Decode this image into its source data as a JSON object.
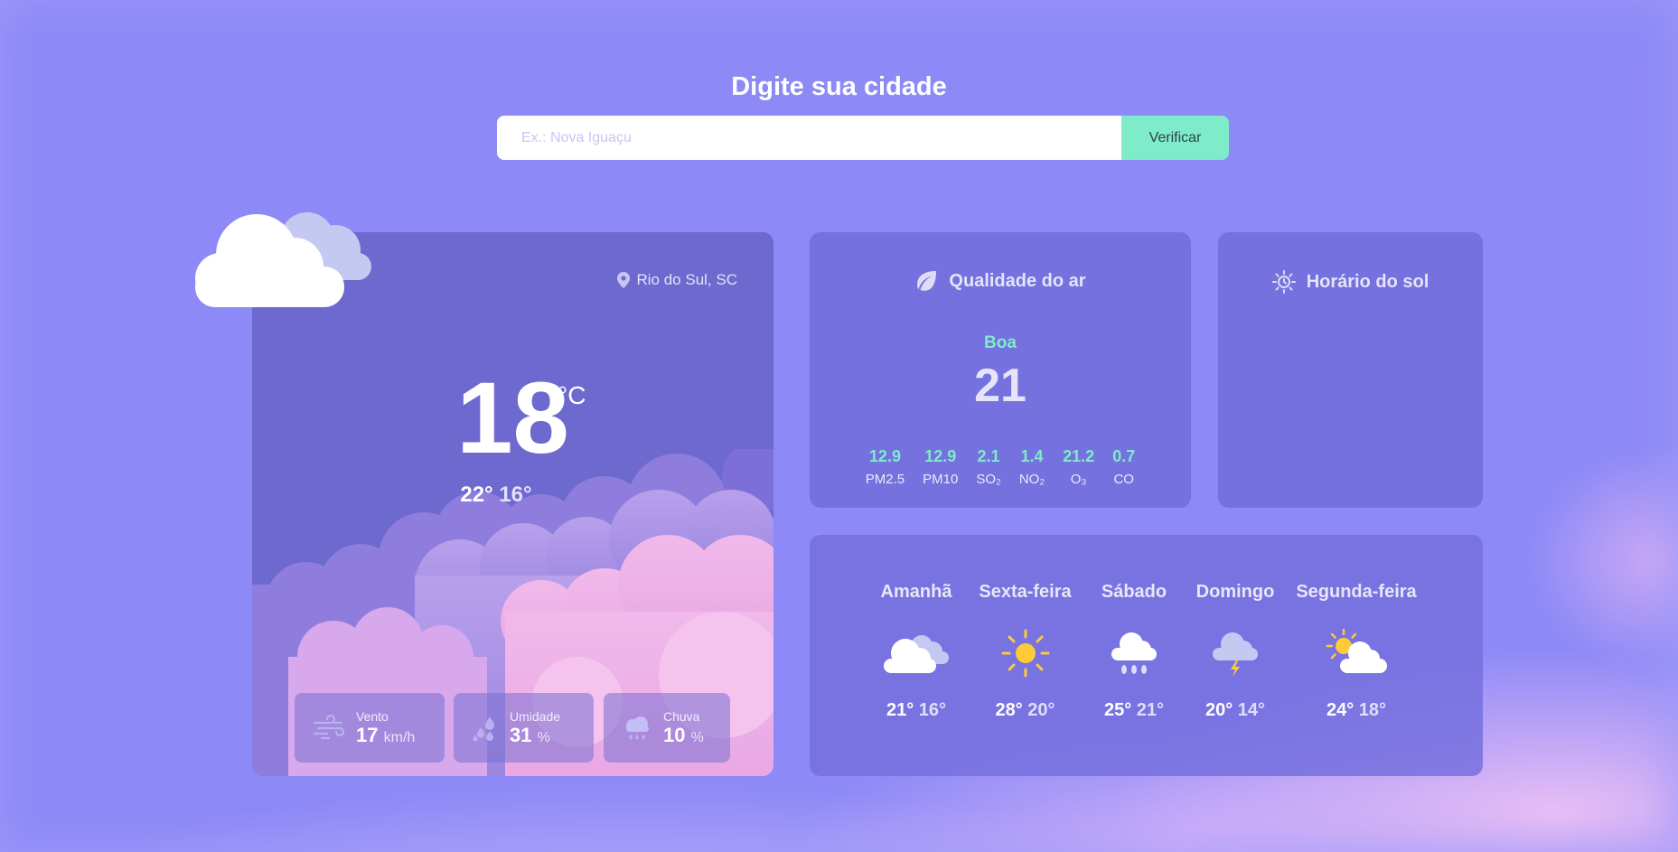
{
  "search": {
    "title": "Digite sua cidade",
    "placeholder": "Ex.: Nova Iguaçu",
    "button_label": "Verificar"
  },
  "current": {
    "location": "Rio do Sul, SC",
    "temperature": "18",
    "unit": "°C",
    "max": "22°",
    "min": "16°",
    "icon": "cloud-icon",
    "stats": [
      {
        "label": "Vento",
        "value": "17",
        "unit": "km/h",
        "icon": "wind-icon"
      },
      {
        "label": "Umidade",
        "value": "31",
        "unit": "%",
        "icon": "humidity-icon"
      },
      {
        "label": "Chuva",
        "value": "10",
        "unit": "%",
        "icon": "rain-cloud-icon"
      }
    ]
  },
  "air": {
    "title": "Qualidade do ar",
    "icon": "leaf-icon",
    "status": "Boa",
    "index": "21",
    "pollutants": [
      {
        "value": "12.9",
        "name": "PM2.5"
      },
      {
        "value": "12.9",
        "name": "PM10"
      },
      {
        "value": "2.1",
        "name": "SO₂"
      },
      {
        "value": "1.4",
        "name": "NO₂"
      },
      {
        "value": "21.2",
        "name": "O₃"
      },
      {
        "value": "0.7",
        "name": "CO"
      }
    ]
  },
  "sun": {
    "title": "Horário do sol",
    "icon": "sun-clock-icon"
  },
  "forecast": [
    {
      "day": "Amanhã",
      "max": "21°",
      "min": "16°",
      "icon": "cloudy-icon"
    },
    {
      "day": "Sexta-feira",
      "max": "28°",
      "min": "20°",
      "icon": "sunny-icon"
    },
    {
      "day": "Sábado",
      "max": "25°",
      "min": "21°",
      "icon": "rain-icon"
    },
    {
      "day": "Domingo",
      "max": "20°",
      "min": "14°",
      "icon": "thunderstorm-icon"
    },
    {
      "day": "Segunda-feira",
      "max": "24°",
      "min": "18°",
      "icon": "partly-cloudy-icon"
    }
  ],
  "colors": {
    "background": "#8d89f6",
    "card": "#6d69cf",
    "accent": "#7eecc8"
  }
}
